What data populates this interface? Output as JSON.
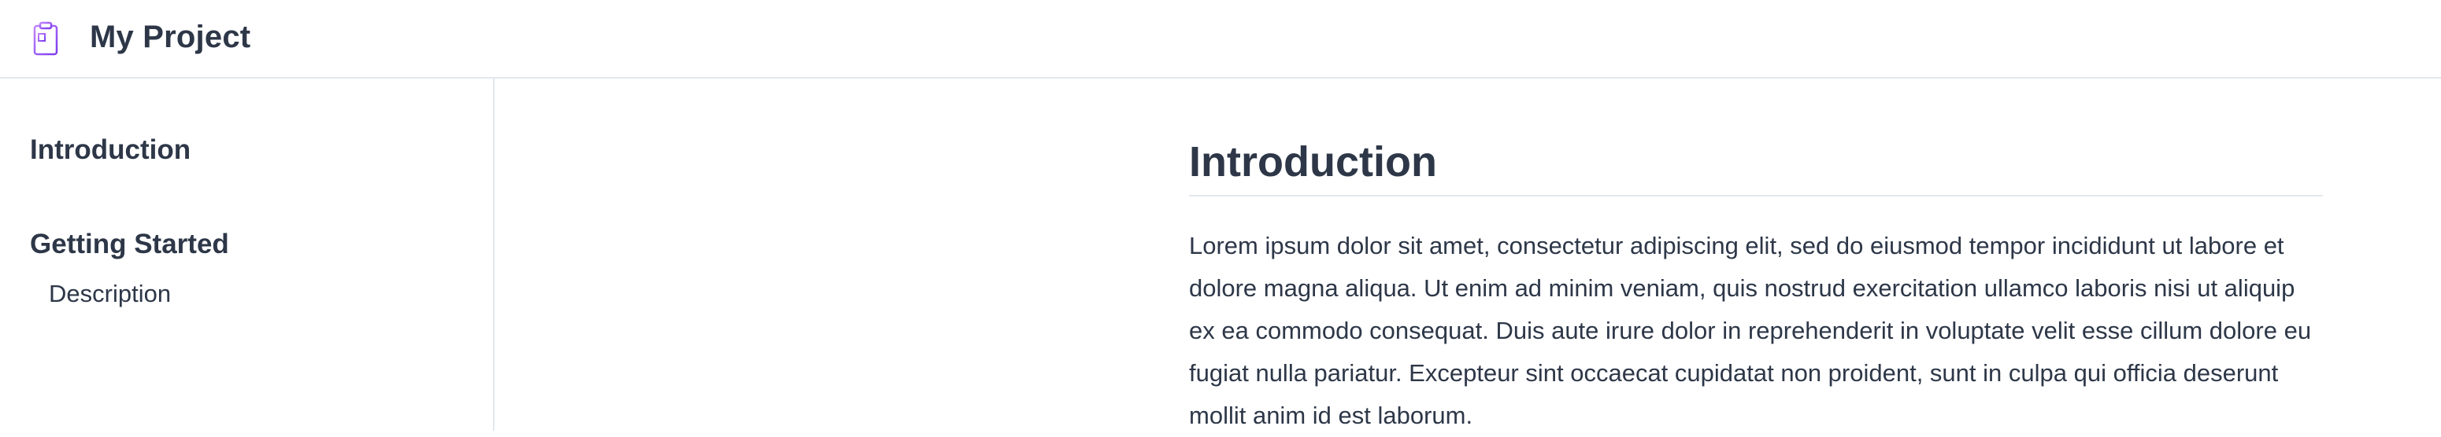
{
  "header": {
    "icon": "clipboard-notes-icon",
    "title": "My Project",
    "accent_colors": [
      "#a855f7",
      "#7c3aed"
    ]
  },
  "sidebar": {
    "sections": [
      {
        "label": "Introduction",
        "items": []
      },
      {
        "label": "Getting Started",
        "items": [
          {
            "label": "Description"
          }
        ]
      }
    ]
  },
  "main": {
    "heading": "Introduction",
    "paragraph": "Lorem ipsum dolor sit amet, consectetur adipiscing elit, sed do eiusmod tempor incididunt ut labore et dolore magna aliqua. Ut enim ad minim veniam, quis nostrud exercitation ullamco laboris nisi ut aliquip ex ea commodo consequat. Duis aute irure dolor in reprehenderit in voluptate velit esse cillum dolore eu fugiat nulla pariatur. Excepteur sint occaecat cupidatat non proident, sunt in culpa qui officia deserunt mollit anim id est laborum."
  }
}
